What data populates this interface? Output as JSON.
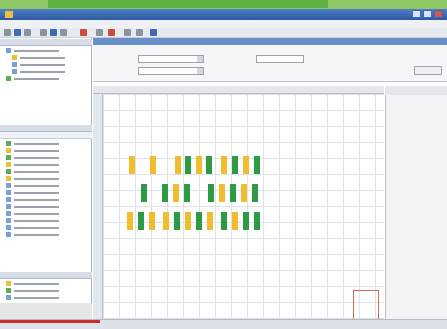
{
  "window": {
    "title": ""
  },
  "menu": {
    "items": [
      "",
      "",
      "",
      "",
      ""
    ]
  },
  "toolbar": {
    "icons": [
      "new-icon",
      "open-icon",
      "save-icon",
      "cut-icon",
      "copy-icon",
      "paste-icon",
      "delete-icon",
      "undo-icon",
      "redo-icon",
      "zoom-icon",
      "print-icon",
      "help-icon"
    ]
  },
  "left_panel": {
    "tree_items": [
      "",
      "",
      "",
      "",
      ""
    ],
    "list_header": [
      "",
      ""
    ],
    "list_items": [
      "",
      "",
      "",
      "",
      "",
      "",
      "",
      "",
      "",
      "",
      "",
      "",
      "",
      ""
    ],
    "bottom_items": [
      "",
      "",
      ""
    ]
  },
  "form": {
    "field1_label": "",
    "field1_value": "",
    "field2_label": "",
    "field2_value": "",
    "field3_label": "",
    "field3_value": "",
    "action_button": ""
  },
  "grid": {
    "columns": [
      "",
      "",
      "",
      "",
      "",
      "",
      "",
      "",
      "",
      "",
      "",
      "",
      "",
      "",
      "",
      "",
      ""
    ],
    "rows": [
      "",
      "",
      "",
      "",
      "",
      "",
      "",
      "",
      "",
      "",
      "",
      "",
      "",
      "",
      ""
    ]
  },
  "right_panel": {
    "title": ""
  },
  "status": {
    "text": ""
  },
  "colors": {
    "accent": "#2d59a3",
    "yellow": "#f2bd2c",
    "green": "#2f9a44",
    "highlight": "#e06a50"
  }
}
